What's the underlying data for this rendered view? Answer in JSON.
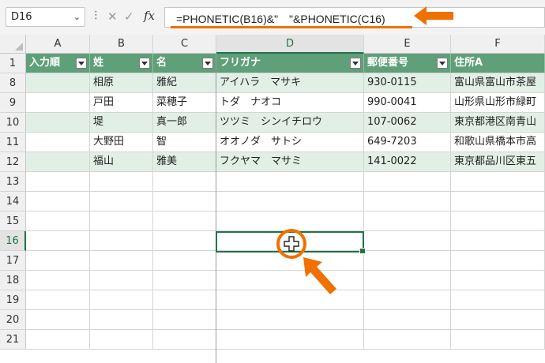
{
  "formula_bar": {
    "name_box": "D16",
    "name_box_arrow": "⌄",
    "kebab": "⋮",
    "cancel": "✕",
    "enter": "✓",
    "fx": "fx",
    "formula": "=PHONETIC(B16)&\"　\"&PHONETIC(C16)"
  },
  "columns": [
    "A",
    "B",
    "C",
    "D",
    "E",
    "F"
  ],
  "header_row": {
    "row": "1",
    "cells": [
      "入力順",
      "姓",
      "名",
      "フリガナ",
      "郵便番号",
      "住所A"
    ]
  },
  "rows": [
    {
      "row": "8",
      "cells": [
        "",
        "相原",
        "雅紀",
        "アイハラ　マサキ",
        "930-0115",
        "富山県富山市茶屋"
      ]
    },
    {
      "row": "9",
      "cells": [
        "",
        "戸田",
        "菜穂子",
        "トダ　ナオコ",
        "990-0041",
        "山形県山形市緑町"
      ]
    },
    {
      "row": "10",
      "cells": [
        "",
        "堤",
        "真一郎",
        "ツツミ　シンイチロウ",
        "107-0062",
        "東京都港区南青山"
      ]
    },
    {
      "row": "11",
      "cells": [
        "",
        "大野田",
        "智",
        "オオノダ　サトシ",
        "649-7203",
        "和歌山県橋本市高"
      ]
    },
    {
      "row": "12",
      "cells": [
        "",
        "福山",
        "雅美",
        "フクヤマ　マサミ",
        "141-0022",
        "東京都品川区東五"
      ]
    },
    {
      "row": "13",
      "cells": [
        "",
        "",
        "",
        "",
        "",
        ""
      ]
    },
    {
      "row": "14",
      "cells": [
        "",
        "",
        "",
        "",
        "",
        ""
      ]
    },
    {
      "row": "15",
      "cells": [
        "",
        "",
        "",
        "",
        "",
        ""
      ]
    },
    {
      "row": "16",
      "cells": [
        "",
        "",
        "",
        "",
        "",
        ""
      ]
    },
    {
      "row": "17",
      "cells": [
        "",
        "",
        "",
        "",
        "",
        ""
      ]
    },
    {
      "row": "18",
      "cells": [
        "",
        "",
        "",
        "",
        "",
        ""
      ]
    },
    {
      "row": "19",
      "cells": [
        "",
        "",
        "",
        "",
        "",
        ""
      ]
    },
    {
      "row": "20",
      "cells": [
        "",
        "",
        "",
        "",
        "",
        ""
      ]
    },
    {
      "row": "21",
      "cells": [
        "",
        "",
        "",
        "",
        "",
        ""
      ]
    }
  ],
  "selection": {
    "cell": "D16",
    "column": "D",
    "row": "16"
  },
  "colors": {
    "accent": "#f07000",
    "excel_green": "#217346",
    "header_fill": "#5f9f7a",
    "band_fill": "#e2efe6"
  }
}
